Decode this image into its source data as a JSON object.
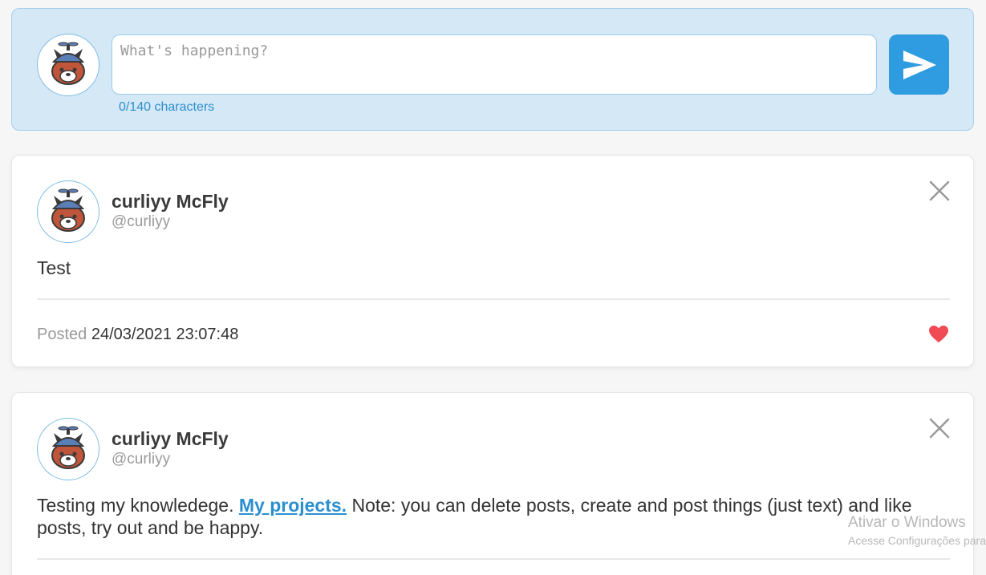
{
  "composer": {
    "placeholder": "What's happening?",
    "value": "",
    "char_count": "0/140 characters",
    "send_icon": "send-icon",
    "colors": {
      "background": "#d5e8f6",
      "accent": "#2f9be0"
    }
  },
  "posts": [
    {
      "author_name": "curliyy McFly",
      "author_handle": "@curliyy",
      "text": "Test",
      "posted_label": "Posted",
      "timestamp": "24/03/2021 23:07:48",
      "liked": true
    },
    {
      "author_name": "curliyy McFly",
      "author_handle": "@curliyy",
      "text_before": "Testing my knowledege.",
      "link_text": "My projects.",
      "text_after": "Note: you can delete posts, create and post things (just text) and like posts, try out and be happy."
    }
  ],
  "watermark": {
    "line1": "Ativar o Windows",
    "line2": "Acesse Configurações para"
  },
  "icons": {
    "close": "close-icon",
    "like": "heart-icon",
    "avatar": "red-panda-avatar-icon"
  }
}
